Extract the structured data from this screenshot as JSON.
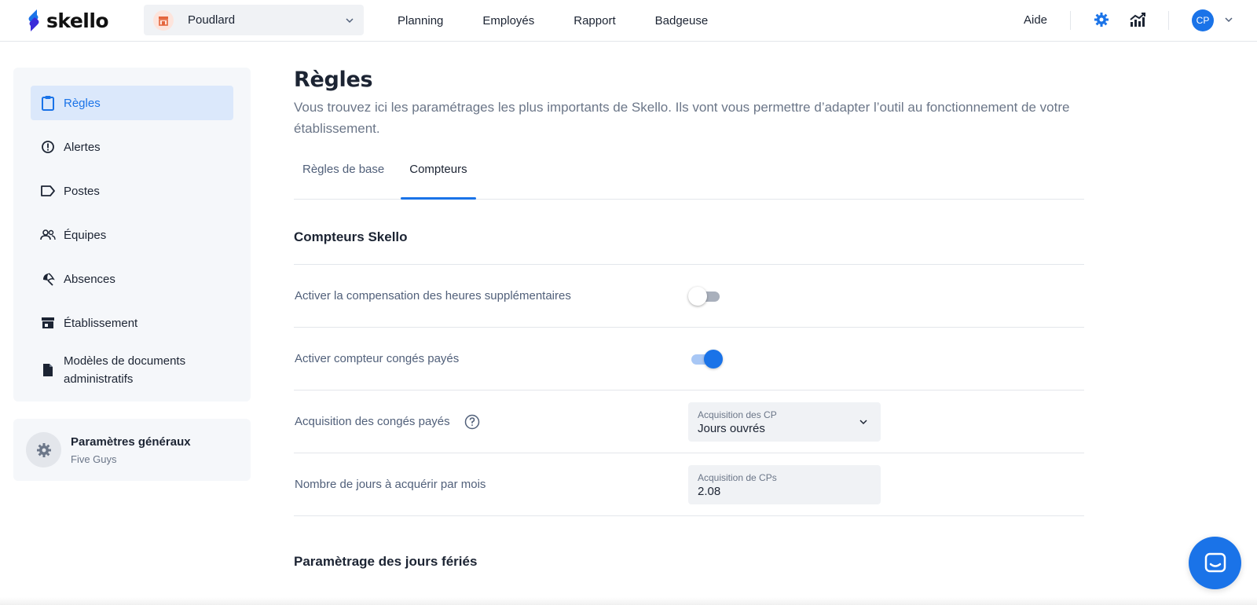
{
  "app": {
    "logo_text": "skello"
  },
  "topbar": {
    "shop_name": "Poudlard",
    "nav": [
      "Planning",
      "Employés",
      "Rapport",
      "Badgeuse"
    ],
    "help": "Aide",
    "avatar_initials": "CP"
  },
  "sidebar": {
    "items": [
      {
        "label": "Règles",
        "icon": "clipboard-icon",
        "active": true
      },
      {
        "label": "Alertes",
        "icon": "alert-circle-icon"
      },
      {
        "label": "Postes",
        "icon": "tag-icon"
      },
      {
        "label": "Équipes",
        "icon": "users-icon"
      },
      {
        "label": "Absences",
        "icon": "beach-umbrella-icon"
      },
      {
        "label": "Établissement",
        "icon": "store-icon"
      },
      {
        "label": "Modèles de documents administratifs",
        "icon": "document-icon"
      }
    ],
    "general": {
      "title": "Paramètres généraux",
      "subtitle": "Five Guys"
    }
  },
  "main": {
    "title": "Règles",
    "description": "Vous trouvez ici les paramétrages les plus importants de Skello. Ils vont vous permettre d’adapter l’outil au fonctionnement de votre établissement.",
    "tabs": [
      {
        "label": "Règles de base",
        "active": false
      },
      {
        "label": "Compteurs",
        "active": true
      }
    ],
    "section_title": "Compteurs Skello",
    "rows": [
      {
        "label": "Activer la compensation des heures supplémentaires",
        "control": "toggle",
        "on": false
      },
      {
        "label": "Activer compteur congés payés",
        "control": "toggle",
        "on": true
      },
      {
        "label": "Acquisition des congés payés",
        "control": "select",
        "field_label": "Acquisition des CP",
        "field_value": "Jours ouvrés"
      },
      {
        "label": "Nombre de jours à acquérir par mois",
        "control": "input",
        "field_label": "Acquisition de CPs",
        "field_value": "2.08"
      }
    ],
    "section2_title": "Paramètrage des jours fériés"
  },
  "colors": {
    "accent": "#1a73e8",
    "active_bg": "#dbe8fb",
    "sidebar_bg": "#f5f7fa"
  }
}
